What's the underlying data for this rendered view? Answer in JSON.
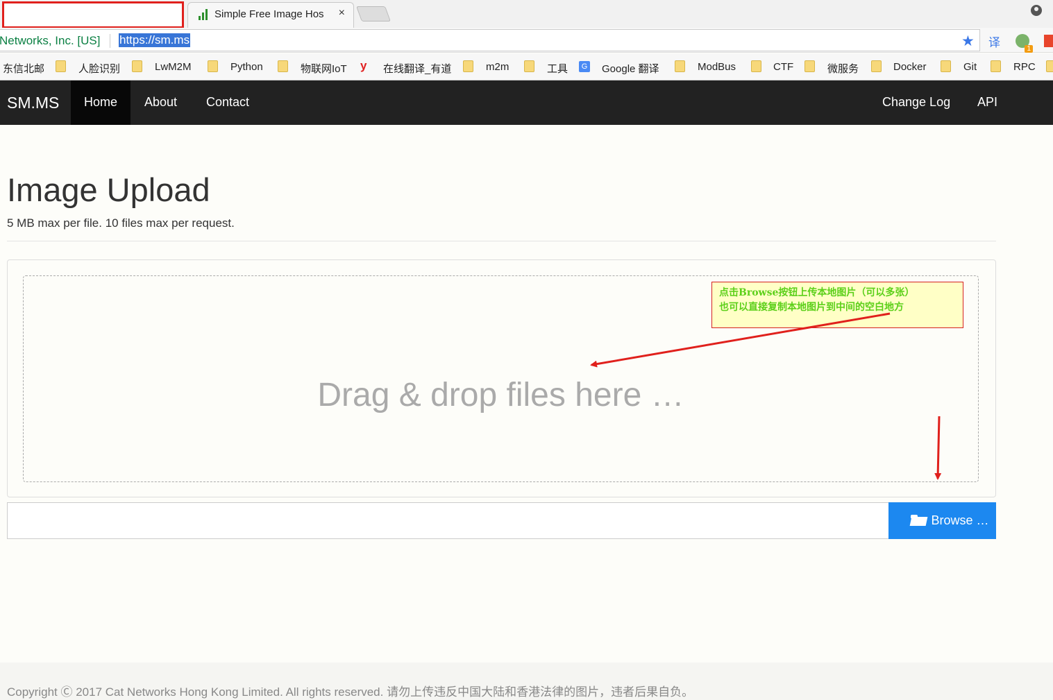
{
  "tab": {
    "title": "Simple Free Image Hos",
    "close": "×"
  },
  "address": {
    "cert": "Networks, Inc. [US]",
    "url": "https://sm.ms"
  },
  "extensions": {
    "translate": "译",
    "badge": "1"
  },
  "bookmarks": [
    "东信北邮",
    "人脸识别",
    "LwM2M",
    "Python",
    "物联网IoT",
    "在线翻译_有道",
    "m2m",
    "工具",
    "Google 翻译",
    "ModBus",
    "CTF",
    "微服务",
    "Docker",
    "Git",
    "RPC"
  ],
  "navbar": {
    "brand": "SM.MS",
    "left": [
      "Home",
      "About",
      "Contact"
    ],
    "right": [
      "Change Log",
      "API"
    ]
  },
  "main": {
    "title": "Image Upload",
    "subtitle": "5 MB max per file. 10 files max per request.",
    "drop_text": "Drag & drop files here …",
    "browse_label": "Browse …",
    "note_line1": "点击Browse按钮上传本地图片（可以多张）",
    "note_line2": "也可以直接复制本地图片到中间的空白地方"
  },
  "footer": {
    "text": "Copyright Ⓒ 2017 Cat Networks Hong Kong Limited. All rights reserved. 请勿上传违反中国大陆和香港法律的图片，违者后果自负。"
  },
  "colors": {
    "navbar": "#222222",
    "browse": "#1c88f0",
    "arrow": "#e0201c",
    "note_text": "#5cd01a"
  }
}
